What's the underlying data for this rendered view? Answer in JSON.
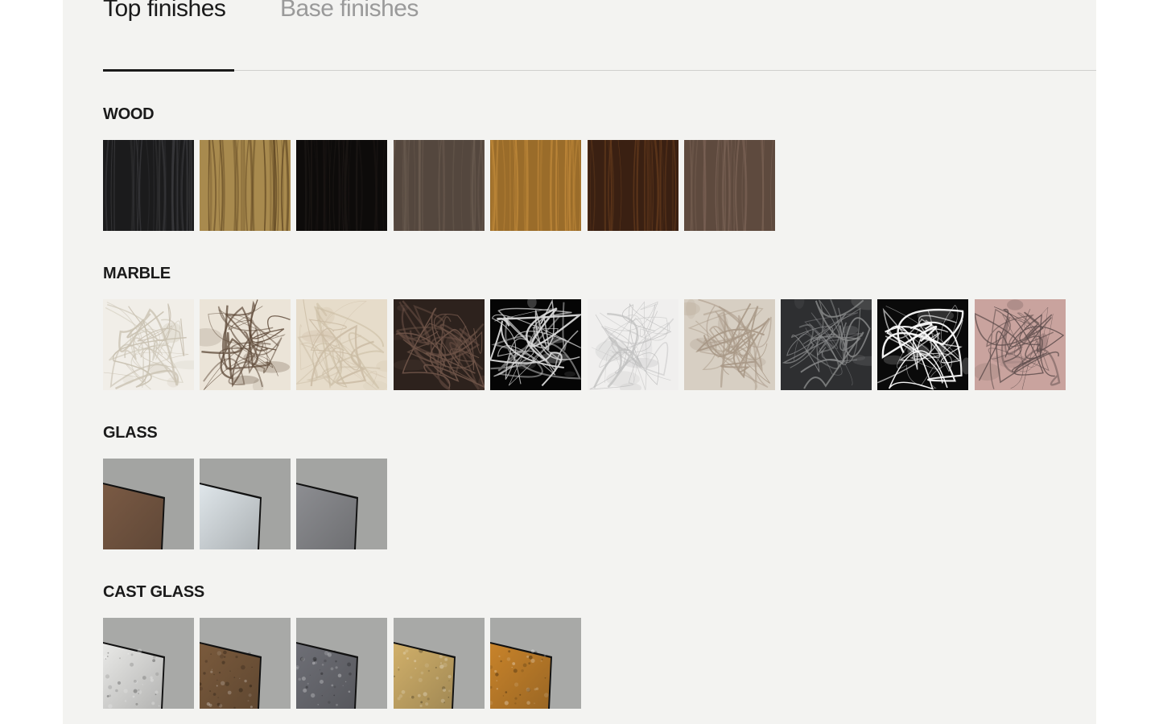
{
  "tabs": [
    {
      "label": "Top finishes",
      "active": true
    },
    {
      "label": "Base finishes",
      "active": false
    }
  ],
  "sections": {
    "wood": {
      "title": "WOOD",
      "swatches": [
        {
          "colors": [
            "#1b1b1c",
            "#3c3c3f"
          ]
        },
        {
          "colors": [
            "#a88a4e",
            "#5c4320"
          ]
        },
        {
          "colors": [
            "#0d0b0a",
            "#1d1816"
          ]
        },
        {
          "colors": [
            "#54473e",
            "#6b5c50"
          ]
        },
        {
          "colors": [
            "#9a6c2a",
            "#c48c3c"
          ]
        },
        {
          "colors": [
            "#3a2012",
            "#6a3e1e"
          ]
        },
        {
          "colors": [
            "#5e4a3e",
            "#7b6356"
          ]
        }
      ]
    },
    "marble": {
      "title": "MARBLE",
      "swatches": [
        {
          "colors": [
            "#f1eee8",
            "#c9c1b1"
          ]
        },
        {
          "colors": [
            "#ebe4d8",
            "#5a4634"
          ]
        },
        {
          "colors": [
            "#e6dcca",
            "#cbbca4"
          ]
        },
        {
          "colors": [
            "#2d221d",
            "#6e5448"
          ]
        },
        {
          "colors": [
            "#050505",
            "#d9d9d9"
          ]
        },
        {
          "colors": [
            "#f0efee",
            "#bdbdbd"
          ]
        },
        {
          "colors": [
            "#d7cfc3",
            "#a89886"
          ]
        },
        {
          "colors": [
            "#2e2f31",
            "#8a8b8c"
          ]
        },
        {
          "colors": [
            "#0a0a0a",
            "#ffffff"
          ]
        },
        {
          "colors": [
            "#c9a39e",
            "#5b4b4a"
          ]
        }
      ]
    },
    "glass": {
      "title": "GLASS",
      "swatches": [
        {
          "colors": [
            "#a3a4a2",
            "#7a5a44"
          ]
        },
        {
          "colors": [
            "#a3a4a2",
            "#dfe6ea"
          ]
        },
        {
          "colors": [
            "#a3a4a2",
            "#8d8e92"
          ]
        }
      ]
    },
    "cast_glass": {
      "title": "CAST GLASS",
      "swatches": [
        {
          "colors": [
            "#a8a9a7",
            "#e9e9e7"
          ]
        },
        {
          "colors": [
            "#a8a9a7",
            "#7a5a3c"
          ]
        },
        {
          "colors": [
            "#a8a9a7",
            "#6e6f76"
          ]
        },
        {
          "colors": [
            "#a8a9a7",
            "#d1b06a"
          ]
        },
        {
          "colors": [
            "#a8a9a7",
            "#c8832a"
          ]
        }
      ]
    }
  }
}
